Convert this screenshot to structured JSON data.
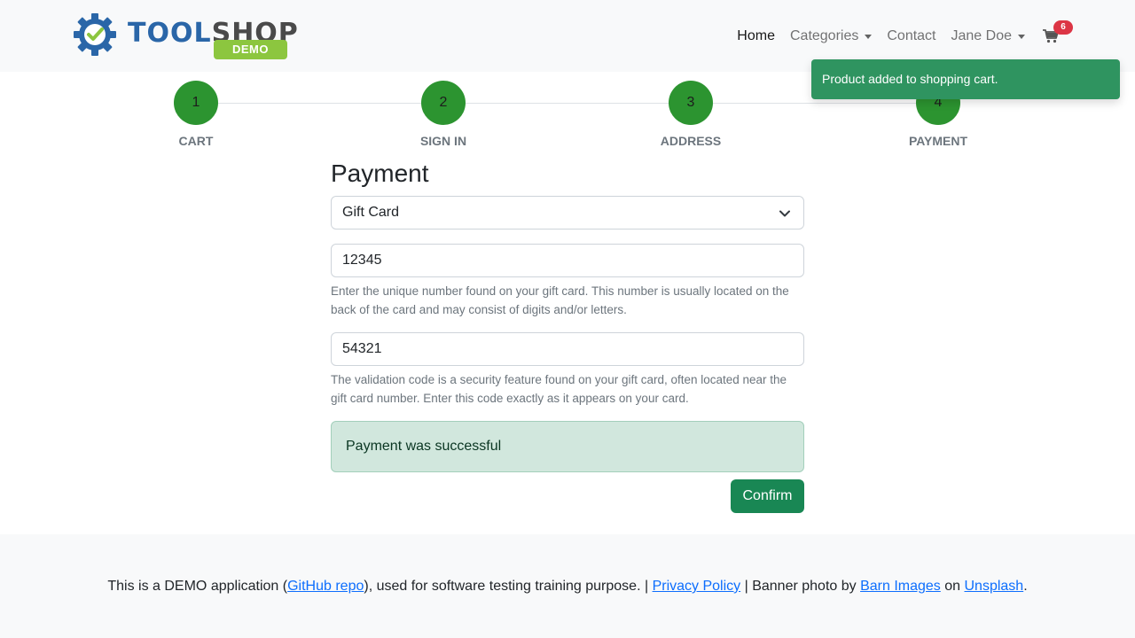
{
  "logo": {
    "brand_part1": "TOOL",
    "brand_part2": "SHOP",
    "demo_label": "DEMO",
    "gear_color": "#2a66a8",
    "check_color": "#8cc63f"
  },
  "nav": {
    "home": "Home",
    "categories": "Categories",
    "contact": "Contact",
    "user": "Jane Doe",
    "cart_count": "6",
    "cart_icon": "shopping-cart-icon"
  },
  "toast": {
    "message": "Product added to shopping cart."
  },
  "steps": [
    {
      "number": "1",
      "label": "CART"
    },
    {
      "number": "2",
      "label": "SIGN IN"
    },
    {
      "number": "3",
      "label": "ADDRESS"
    },
    {
      "number": "4",
      "label": "PAYMENT"
    }
  ],
  "payment": {
    "title": "Payment",
    "method": "Gift Card",
    "gift_card_number": "12345",
    "gift_card_help": "Enter the unique number found on your gift card. This number is usually located on the back of the card and may consist of digits and/or letters.",
    "validation_code": "54321",
    "validation_help": "The validation code is a security feature found on your gift card, often located near the gift card number. Enter this code exactly as it appears on your card.",
    "alert": "Payment was successful",
    "confirm_label": "Confirm"
  },
  "footer": {
    "text1": "This is a DEMO application (",
    "github_link": "GitHub repo",
    "text2": "), used for software testing training purpose. | ",
    "privacy_link": "Privacy Policy",
    "text3": " | Banner photo by ",
    "barn_link": "Barn Images",
    "text4": " on ",
    "unsplash_link": "Unsplash",
    "text5": "."
  },
  "colors": {
    "step_green": "#2c9430",
    "toast_green": "#2f9460",
    "confirm_green": "#198754",
    "badge_red": "#dc3545",
    "link_blue": "#0d6efd"
  }
}
